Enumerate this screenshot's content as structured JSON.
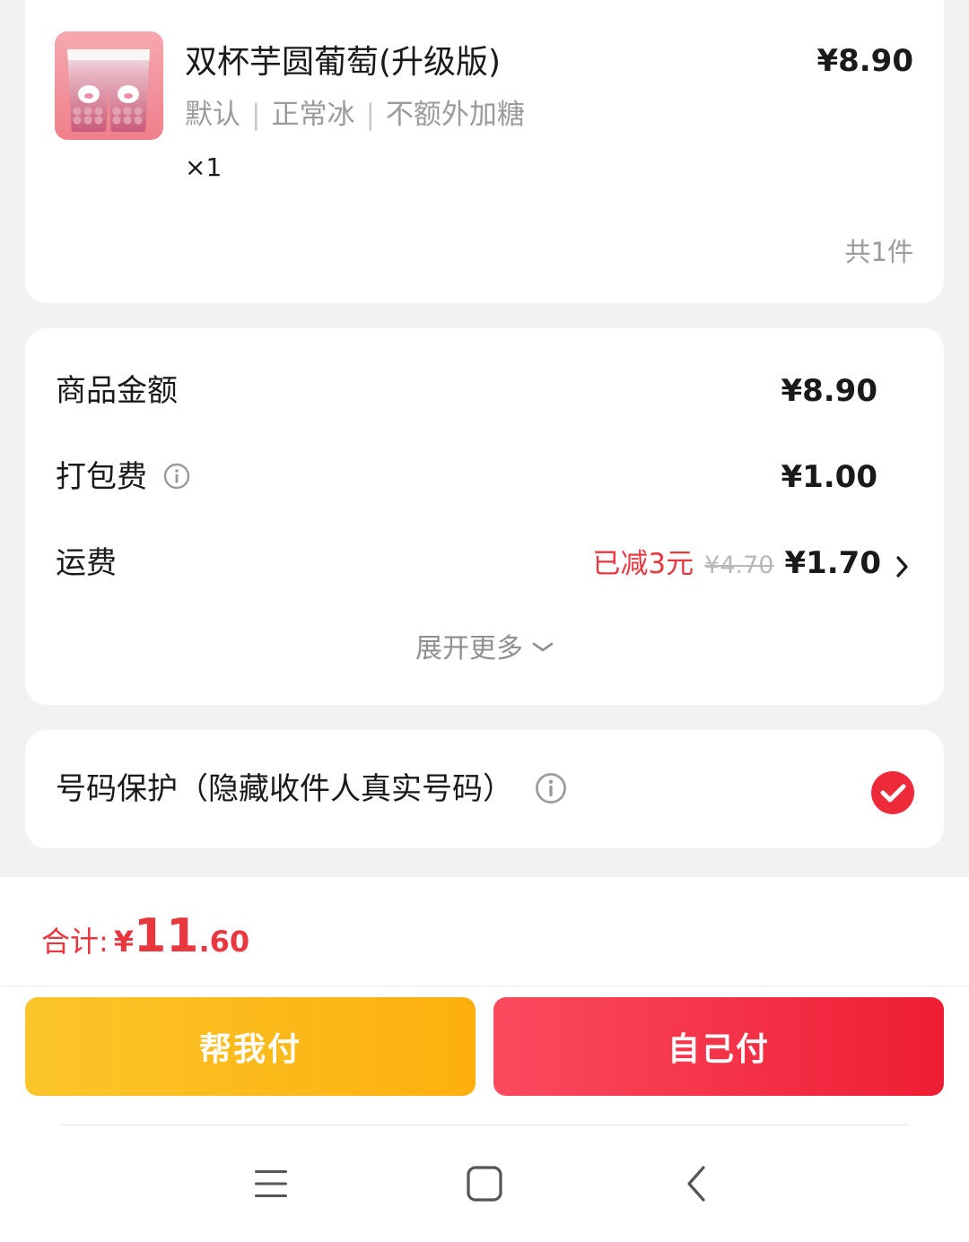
{
  "product": {
    "name": "双杯芋圆葡萄(升级版)",
    "price": "¥8.90",
    "specs": [
      "默认",
      "正常冰",
      "不额外加糖"
    ],
    "quantity": "×1",
    "item_count": "共1件"
  },
  "fees": {
    "goods_amount_label": "商品金额",
    "goods_amount_value": "¥8.90",
    "packing_fee_label": "打包费",
    "packing_fee_value": "¥1.00",
    "shipping_label": "运费",
    "shipping_discount": "已减3元",
    "shipping_original": "¥4.70",
    "shipping_value": "¥1.70",
    "expand_more": "展开更多"
  },
  "privacy": {
    "label": "号码保护（隐藏收件人真实号码）",
    "checked": true
  },
  "summary": {
    "total_label": "合计:",
    "currency": "¥",
    "total_int": "11",
    "total_dec": ".60"
  },
  "actions": {
    "help_pay": "帮我付",
    "self_pay": "自己付"
  },
  "colors": {
    "accent_red": "#e8373f",
    "help_pay_yellow": "#fdb00d",
    "self_pay_red": "#ee1d34"
  },
  "icons": [
    "info-icon",
    "chevron-right-icon",
    "chevron-down-icon",
    "check-circle-icon",
    "menu-icon",
    "home-icon",
    "back-icon"
  ]
}
